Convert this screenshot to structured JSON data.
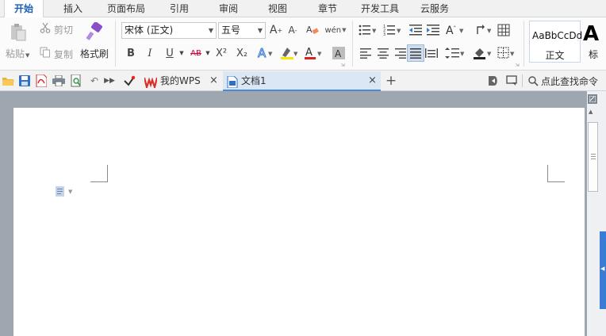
{
  "menu": {
    "tabs": [
      {
        "label": "开始",
        "active": true
      },
      {
        "label": "插入"
      },
      {
        "label": "页面布局"
      },
      {
        "label": "引用"
      },
      {
        "label": "审阅"
      },
      {
        "label": "视图"
      },
      {
        "label": "章节"
      },
      {
        "label": "开发工具"
      },
      {
        "label": "云服务"
      }
    ]
  },
  "ribbon": {
    "paste_label": "粘贴",
    "cut_label": "剪切",
    "copy_label": "复制",
    "format_painter_label": "格式刷",
    "font_name": "宋体 (正文)",
    "font_size": "五号",
    "bold": "B",
    "italic": "I",
    "underline": "U",
    "strikethrough": "AB",
    "superscript": "X²",
    "subscript": "X₂",
    "font_color_glyph": "A",
    "style_sample_normal": "AaBbCcDd",
    "style_normal_label": "正文",
    "style_sample_heading": "A",
    "style_heading_label": "标"
  },
  "quickbar": {
    "tabs": [
      {
        "label": "我的WPS"
      },
      {
        "label": "文档1",
        "active": true
      }
    ],
    "search_label": "点此查找命令"
  },
  "colors": {
    "accent": "#1b5fb7",
    "wps_red": "#d9302c",
    "doc_tab_active": "#dce7f5",
    "workspace": "#9ea6b0"
  }
}
